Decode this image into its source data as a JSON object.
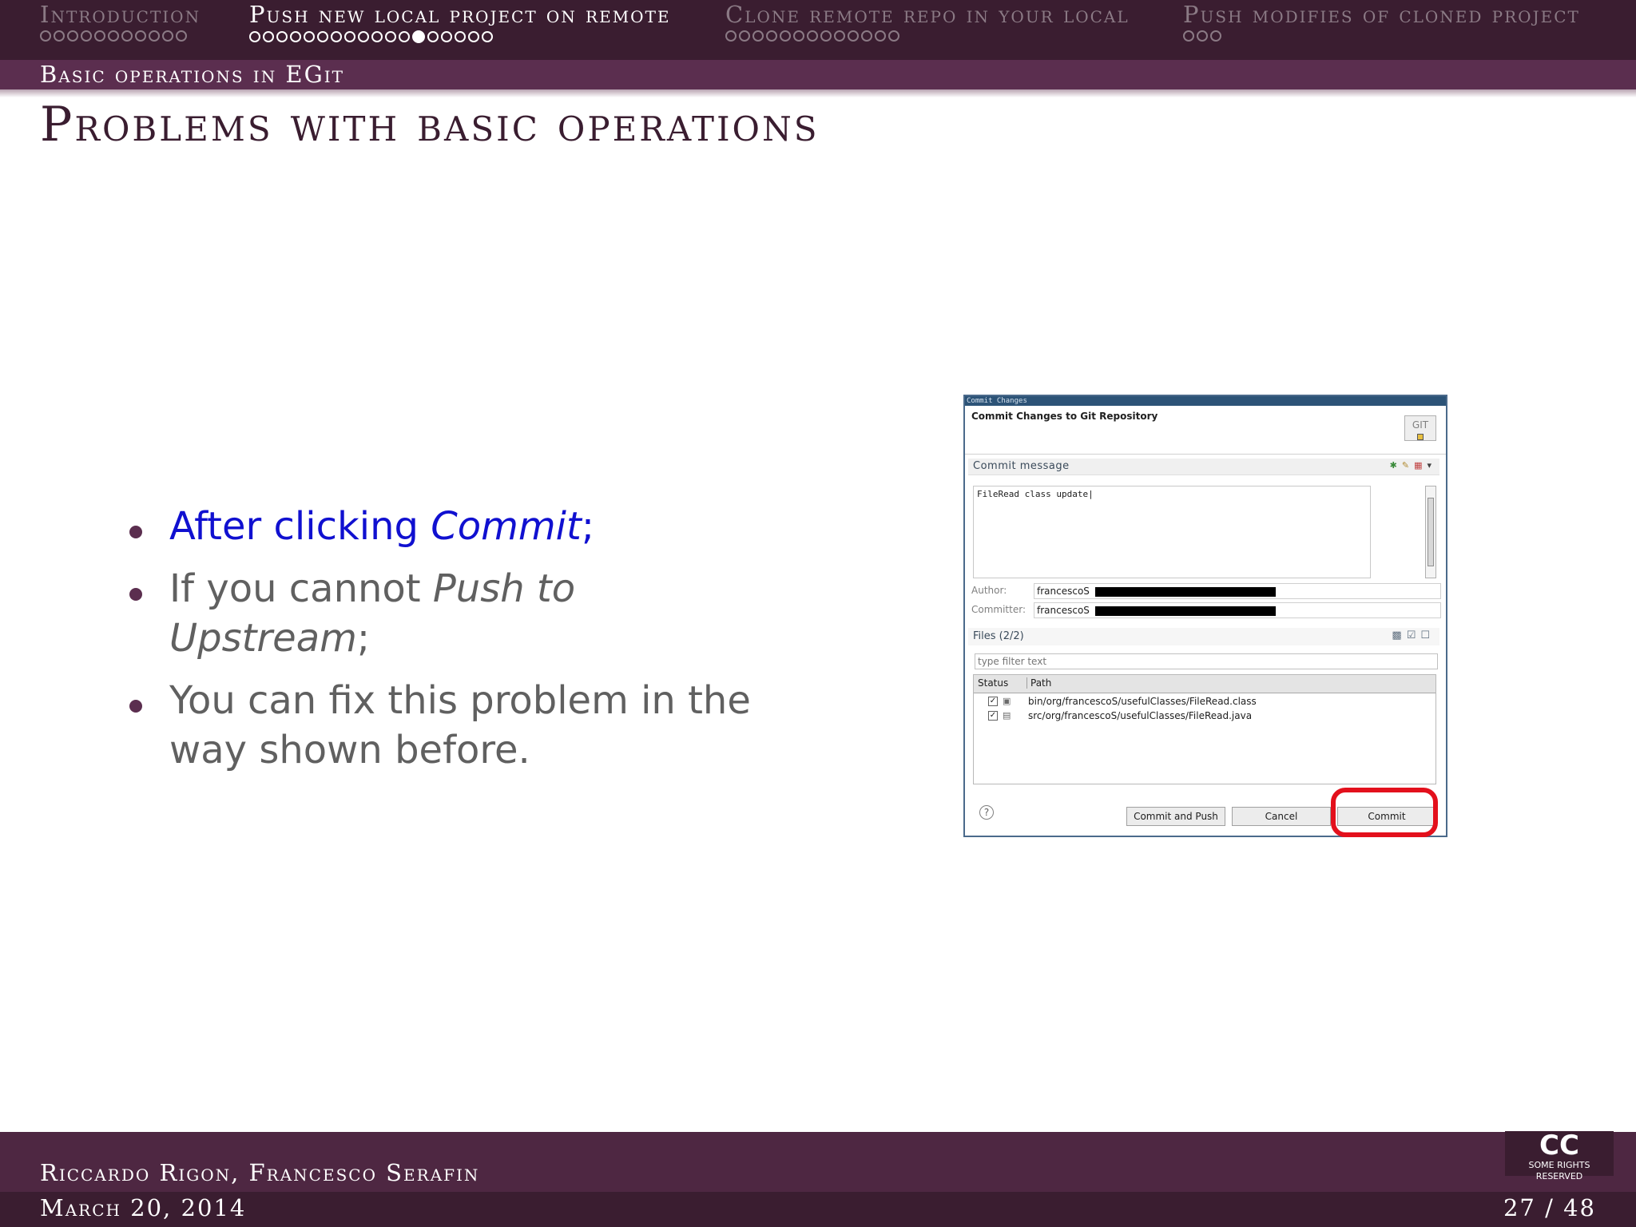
{
  "header": {
    "sections": [
      {
        "title": "Introduction",
        "dots": 11,
        "filled_index": -1,
        "active": false
      },
      {
        "title": "Push new local project on remote",
        "dots": 18,
        "filled_index": 12,
        "active": true
      },
      {
        "title": "Clone remote repo in your local",
        "dots": 13,
        "filled_index": -1,
        "active": false
      },
      {
        "title": "Push modifies of cloned project",
        "dots": 3,
        "filled_index": -1,
        "active": false
      }
    ],
    "subsection": "Basic operations in EGit"
  },
  "slide": {
    "title": "Problems with basic operations",
    "bullets": [
      {
        "before": "After clicking ",
        "emph": "Commit",
        "after": ";",
        "highlight": true
      },
      {
        "before": "If you cannot ",
        "emph": "Push to Upstream",
        "after": ";",
        "highlight": false
      },
      {
        "before": "You can fix this problem in the way shown before.",
        "emph": "",
        "after": "",
        "highlight": false
      }
    ]
  },
  "dialog": {
    "window_title": "Commit Changes",
    "heading": "Commit Changes to Git Repository",
    "logo_text": "GIT",
    "commit_message_label": "Commit message",
    "commit_message": "FileRead class update",
    "author_label": "Author:",
    "author_value": "francescoS",
    "committer_label": "Committer:",
    "committer_value": "francescoS",
    "files_label": "Files (2/2)",
    "filter_placeholder": "type filter text",
    "columns": {
      "status": "Status",
      "path": "Path"
    },
    "files": [
      {
        "checked": true,
        "path": "bin/org/francescoS/usefulClasses/FileRead.class"
      },
      {
        "checked": true,
        "path": "src/org/francescoS/usefulClasses/FileRead.java"
      }
    ],
    "buttons": {
      "commit_and_push": "Commit and Push",
      "cancel": "Cancel",
      "commit": "Commit"
    },
    "highlight_color": "#e3101c"
  },
  "footer": {
    "authors": "Riccardo Rigon, Francesco Serafin",
    "date": "March 20, 2014",
    "page": "27 / 48",
    "cc_mark": "CC",
    "cc_text": "SOME RIGHTS RESERVED"
  },
  "colors": {
    "header_bg": "#3a1d30",
    "subsection_bg": "#5b2e4f",
    "title_color": "#3a1d30",
    "bullet_text": "#606060",
    "highlight_text": "#1010d0"
  }
}
